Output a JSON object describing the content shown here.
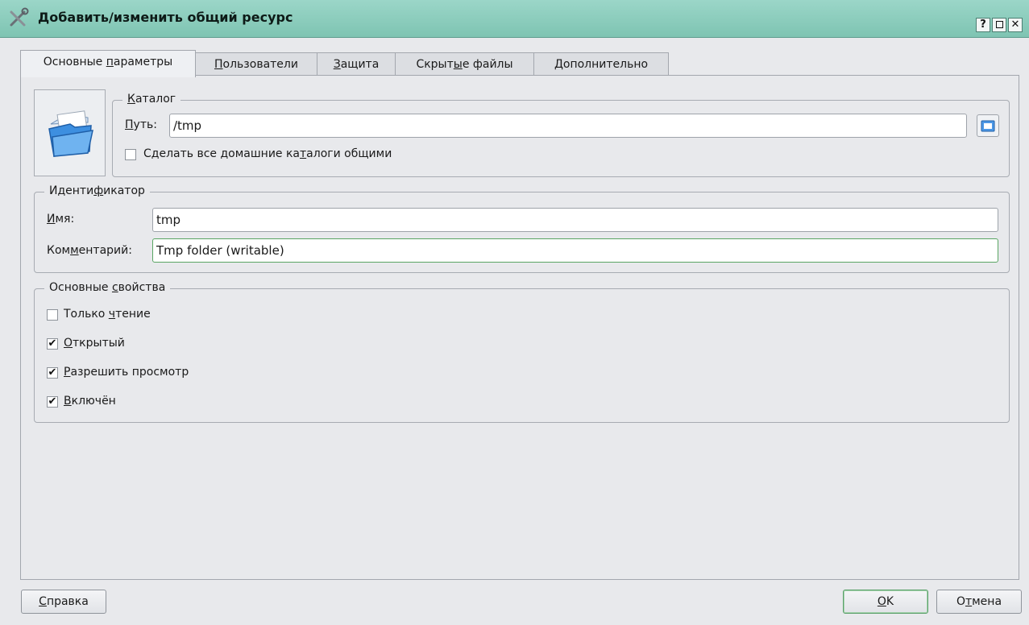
{
  "window": {
    "title": "Добавить/изменить общий ресурс",
    "help_glyph": "?",
    "close_glyph": "✕",
    "icon": "tools-icon"
  },
  "tabs": [
    {
      "pre": "Основные ",
      "acc": "п",
      "post": "араметры"
    },
    {
      "pre": "",
      "acc": "П",
      "post": "ользователи"
    },
    {
      "pre": "",
      "acc": "З",
      "post": "ащита"
    },
    {
      "pre": "Скрыт",
      "acc": "ы",
      "post": "е файлы"
    },
    {
      "pre": "",
      "acc": "Д",
      "post": "ополнительно"
    }
  ],
  "catalog": {
    "legend": {
      "pre": "",
      "acc": "К",
      "post": "аталог"
    },
    "path_label": {
      "pre": "",
      "acc": "П",
      "post": "уть:"
    },
    "path_value": "/tmp",
    "homes_label": {
      "pre": "Сделать все домашние ка",
      "acc": "т",
      "post": "алоги общими"
    },
    "homes_checked": false
  },
  "identifier": {
    "legend": {
      "pre": "Иденти",
      "acc": "ф",
      "post": "икатор"
    },
    "name_label": {
      "pre": "",
      "acc": "И",
      "post": "мя:"
    },
    "name_value": "tmp",
    "comment_label": {
      "pre": "Ком",
      "acc": "м",
      "post": "ентарий:"
    },
    "comment_value": "Tmp folder (writable)"
  },
  "properties": {
    "legend": {
      "pre": "Основные ",
      "acc": "с",
      "post": "войства"
    },
    "items": [
      {
        "pre": "Только ",
        "acc": "ч",
        "post": "тение",
        "checked": false
      },
      {
        "pre": "",
        "acc": "О",
        "post": "ткрытый",
        "checked": true
      },
      {
        "pre": "",
        "acc": "Р",
        "post": "азрешить просмотр",
        "checked": true
      },
      {
        "pre": "",
        "acc": "В",
        "post": "ключён",
        "checked": true
      }
    ]
  },
  "buttons": {
    "help": {
      "pre": "",
      "acc": "С",
      "post": "правка"
    },
    "ok": {
      "pre": "",
      "acc": "O",
      "post": "K"
    },
    "cancel": {
      "pre": "О",
      "acc": "т",
      "post": "мена"
    }
  },
  "check_glyph": "✔",
  "colors": {
    "titlebar": "#8fcfbf",
    "focus_border": "#59a563",
    "folder_blue": "#3d8fe0"
  }
}
